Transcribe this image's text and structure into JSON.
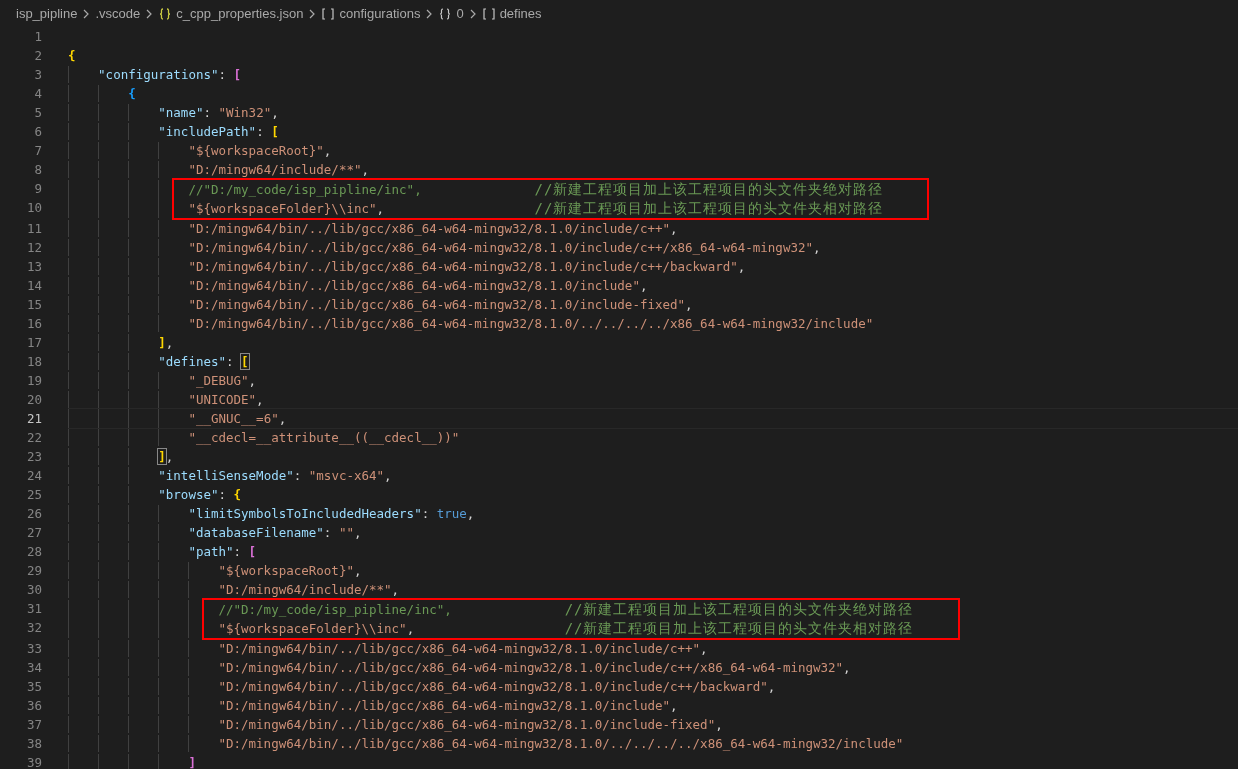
{
  "breadcrumb": [
    {
      "kind": "folder",
      "label": "isp_pipline"
    },
    {
      "kind": "folder",
      "label": ".vscode"
    },
    {
      "kind": "file",
      "label": "c_cpp_properties.json"
    },
    {
      "kind": "array",
      "label": "configurations"
    },
    {
      "kind": "object",
      "label": "0"
    },
    {
      "kind": "array",
      "label": "defines"
    }
  ],
  "lines": [
    {
      "number": "1",
      "active": false,
      "boxed": false
    },
    {
      "number": "2",
      "active": false,
      "boxed": false,
      "tokens": [
        {
          "kind": "bracket",
          "text": "{",
          "color": "#ffd700",
          "matched": false
        }
      ],
      "children": [
        {
          "number": "3",
          "active": false,
          "boxed": false,
          "tokens": [
            {
              "kind": "key",
              "text": "\"configurations\""
            },
            {
              "kind": "punct",
              "text": ": "
            },
            {
              "kind": "bracket",
              "text": "[",
              "color": "#da70d6",
              "matched": false
            }
          ],
          "children": [
            {
              "number": "4",
              "active": false,
              "boxed": false,
              "tokens": [
                {
                  "kind": "bracket",
                  "text": "{",
                  "color": "#179fff",
                  "matched": false
                }
              ],
              "children": [
                {
                  "number": "5",
                  "active": false,
                  "boxed": false,
                  "tokens": [
                    {
                      "kind": "key",
                      "text": "\"name\""
                    },
                    {
                      "kind": "punct",
                      "text": ": "
                    },
                    {
                      "kind": "string",
                      "text": "\"Win32\""
                    },
                    {
                      "kind": "punct",
                      "text": ","
                    }
                  ]
                },
                {
                  "number": "6",
                  "active": false,
                  "boxed": false,
                  "tokens": [
                    {
                      "kind": "key",
                      "text": "\"includePath\""
                    },
                    {
                      "kind": "punct",
                      "text": ": "
                    },
                    {
                      "kind": "bracket",
                      "text": "[",
                      "color": "#ffd700",
                      "matched": false
                    }
                  ],
                  "children": [
                    {
                      "number": "7",
                      "active": false,
                      "boxed": false,
                      "tokens": [
                        {
                          "kind": "string",
                          "text": "\"${workspaceRoot}\""
                        },
                        {
                          "kind": "punct",
                          "text": ","
                        }
                      ]
                    },
                    {
                      "number": "8",
                      "active": false,
                      "boxed": false,
                      "tokens": [
                        {
                          "kind": "string",
                          "text": "\"D:/mingw64/include/**\""
                        },
                        {
                          "kind": "punct",
                          "text": ","
                        }
                      ]
                    },
                    {
                      "number": "9",
                      "active": false,
                      "boxed": true,
                      "tokens": [
                        {
                          "kind": "comment",
                          "text": "//\"D:/my_code/isp_pipline/inc\","
                        }
                      ],
                      "note": "//新建工程项目加上该工程项目的头文件夹绝对路径"
                    },
                    {
                      "number": "10",
                      "active": false,
                      "boxed": true,
                      "tokens": [
                        {
                          "kind": "string",
                          "text": "\"${workspaceFolder}\\\\inc\""
                        },
                        {
                          "kind": "punct",
                          "text": ","
                        }
                      ],
                      "note": "//新建工程项目加上该工程项目的头文件夹相对路径"
                    },
                    {
                      "number": "11",
                      "active": false,
                      "boxed": false,
                      "tokens": [
                        {
                          "kind": "string",
                          "text": "\"D:/mingw64/bin/../lib/gcc/x86_64-w64-mingw32/8.1.0/include/c++\""
                        },
                        {
                          "kind": "punct",
                          "text": ","
                        }
                      ]
                    },
                    {
                      "number": "12",
                      "active": false,
                      "boxed": false,
                      "tokens": [
                        {
                          "kind": "string",
                          "text": "\"D:/mingw64/bin/../lib/gcc/x86_64-w64-mingw32/8.1.0/include/c++/x86_64-w64-mingw32\""
                        },
                        {
                          "kind": "punct",
                          "text": ","
                        }
                      ]
                    },
                    {
                      "number": "13",
                      "active": false,
                      "boxed": false,
                      "tokens": [
                        {
                          "kind": "string",
                          "text": "\"D:/mingw64/bin/../lib/gcc/x86_64-w64-mingw32/8.1.0/include/c++/backward\""
                        },
                        {
                          "kind": "punct",
                          "text": ","
                        }
                      ]
                    },
                    {
                      "number": "14",
                      "active": false,
                      "boxed": false,
                      "tokens": [
                        {
                          "kind": "string",
                          "text": "\"D:/mingw64/bin/../lib/gcc/x86_64-w64-mingw32/8.1.0/include\""
                        },
                        {
                          "kind": "punct",
                          "text": ","
                        }
                      ]
                    },
                    {
                      "number": "15",
                      "active": false,
                      "boxed": false,
                      "tokens": [
                        {
                          "kind": "string",
                          "text": "\"D:/mingw64/bin/../lib/gcc/x86_64-w64-mingw32/8.1.0/include-fixed\""
                        },
                        {
                          "kind": "punct",
                          "text": ","
                        }
                      ]
                    },
                    {
                      "number": "16",
                      "active": false,
                      "boxed": false,
                      "tokens": [
                        {
                          "kind": "string",
                          "text": "\"D:/mingw64/bin/../lib/gcc/x86_64-w64-mingw32/8.1.0/../../../../x86_64-w64-mingw32/include\""
                        }
                      ]
                    }
                  ]
                },
                {
                  "number": "17",
                  "active": false,
                  "boxed": false,
                  "tokens": [
                    {
                      "kind": "bracket",
                      "text": "]",
                      "color": "#ffd700",
                      "matched": false
                    },
                    {
                      "kind": "punct",
                      "text": ","
                    }
                  ]
                },
                {
                  "number": "18",
                  "active": false,
                  "boxed": false,
                  "tokens": [
                    {
                      "kind": "key",
                      "text": "\"defines\""
                    },
                    {
                      "kind": "punct",
                      "text": ": "
                    },
                    {
                      "kind": "bracket",
                      "text": "[",
                      "color": "#ffd700",
                      "matched": true
                    }
                  ],
                  "children": [
                    {
                      "number": "19",
                      "active": false,
                      "boxed": false,
                      "tokens": [
                        {
                          "kind": "string",
                          "text": "\"_DEBUG\""
                        },
                        {
                          "kind": "punct",
                          "text": ","
                        }
                      ]
                    },
                    {
                      "number": "20",
                      "active": false,
                      "boxed": false,
                      "tokens": [
                        {
                          "kind": "string",
                          "text": "\"UNICODE\""
                        },
                        {
                          "kind": "punct",
                          "text": ","
                        }
                      ]
                    },
                    {
                      "number": "21",
                      "active": true,
                      "boxed": false,
                      "tokens": [
                        {
                          "kind": "string",
                          "text": "\"__GNUC__=6\""
                        },
                        {
                          "kind": "punct",
                          "text": ","
                        }
                      ]
                    },
                    {
                      "number": "22",
                      "active": false,
                      "boxed": false,
                      "tokens": [
                        {
                          "kind": "string",
                          "text": "\"__cdecl=__attribute__((__cdecl__))\""
                        }
                      ]
                    }
                  ]
                },
                {
                  "number": "23",
                  "active": false,
                  "boxed": false,
                  "tokens": [
                    {
                      "kind": "bracket",
                      "text": "]",
                      "color": "#ffd700",
                      "matched": true
                    },
                    {
                      "kind": "punct",
                      "text": ","
                    }
                  ]
                },
                {
                  "number": "24",
                  "active": false,
                  "boxed": false,
                  "tokens": [
                    {
                      "kind": "key",
                      "text": "\"intelliSenseMode\""
                    },
                    {
                      "kind": "punct",
                      "text": ": "
                    },
                    {
                      "kind": "string",
                      "text": "\"msvc-x64\""
                    },
                    {
                      "kind": "punct",
                      "text": ","
                    }
                  ]
                },
                {
                  "number": "25",
                  "active": false,
                  "boxed": false,
                  "tokens": [
                    {
                      "kind": "key",
                      "text": "\"browse\""
                    },
                    {
                      "kind": "punct",
                      "text": ": "
                    },
                    {
                      "kind": "bracket",
                      "text": "{",
                      "color": "#ffd700",
                      "matched": false
                    }
                  ],
                  "children": [
                    {
                      "number": "26",
                      "active": false,
                      "boxed": false,
                      "tokens": [
                        {
                          "kind": "key",
                          "text": "\"limitSymbolsToIncludedHeaders\""
                        },
                        {
                          "kind": "punct",
                          "text": ": "
                        },
                        {
                          "kind": "bool",
                          "text": "true"
                        },
                        {
                          "kind": "punct",
                          "text": ","
                        }
                      ]
                    },
                    {
                      "number": "27",
                      "active": false,
                      "boxed": false,
                      "tokens": [
                        {
                          "kind": "key",
                          "text": "\"databaseFilename\""
                        },
                        {
                          "kind": "punct",
                          "text": ": "
                        },
                        {
                          "kind": "string",
                          "text": "\"\""
                        },
                        {
                          "kind": "punct",
                          "text": ","
                        }
                      ]
                    },
                    {
                      "number": "28",
                      "active": false,
                      "boxed": false,
                      "tokens": [
                        {
                          "kind": "key",
                          "text": "\"path\""
                        },
                        {
                          "kind": "punct",
                          "text": ": "
                        },
                        {
                          "kind": "bracket",
                          "text": "[",
                          "color": "#da70d6",
                          "matched": false
                        }
                      ],
                      "children": [
                        {
                          "number": "29",
                          "active": false,
                          "boxed": false,
                          "tokens": [
                            {
                              "kind": "string",
                              "text": "\"${workspaceRoot}\""
                            },
                            {
                              "kind": "punct",
                              "text": ","
                            }
                          ]
                        },
                        {
                          "number": "30",
                          "active": false,
                          "boxed": false,
                          "tokens": [
                            {
                              "kind": "string",
                              "text": "\"D:/mingw64/include/**\""
                            },
                            {
                              "kind": "punct",
                              "text": ","
                            }
                          ]
                        },
                        {
                          "number": "31",
                          "active": false,
                          "boxed": true,
                          "tokens": [
                            {
                              "kind": "comment",
                              "text": "//\"D:/my_code/isp_pipline/inc\","
                            }
                          ],
                          "note": "//新建工程项目加上该工程项目的头文件夹绝对路径"
                        },
                        {
                          "number": "32",
                          "active": false,
                          "boxed": true,
                          "tokens": [
                            {
                              "kind": "string",
                              "text": "\"${workspaceFolder}\\\\inc\""
                            },
                            {
                              "kind": "punct",
                              "text": ","
                            }
                          ],
                          "note": "//新建工程项目加上该工程项目的头文件夹相对路径"
                        },
                        {
                          "number": "33",
                          "active": false,
                          "boxed": false,
                          "tokens": [
                            {
                              "kind": "string",
                              "text": "\"D:/mingw64/bin/../lib/gcc/x86_64-w64-mingw32/8.1.0/include/c++\""
                            },
                            {
                              "kind": "punct",
                              "text": ","
                            }
                          ]
                        },
                        {
                          "number": "34",
                          "active": false,
                          "boxed": false,
                          "tokens": [
                            {
                              "kind": "string",
                              "text": "\"D:/mingw64/bin/../lib/gcc/x86_64-w64-mingw32/8.1.0/include/c++/x86_64-w64-mingw32\""
                            },
                            {
                              "kind": "punct",
                              "text": ","
                            }
                          ]
                        },
                        {
                          "number": "35",
                          "active": false,
                          "boxed": false,
                          "tokens": [
                            {
                              "kind": "string",
                              "text": "\"D:/mingw64/bin/../lib/gcc/x86_64-w64-mingw32/8.1.0/include/c++/backward\""
                            },
                            {
                              "kind": "punct",
                              "text": ","
                            }
                          ]
                        },
                        {
                          "number": "36",
                          "active": false,
                          "boxed": false,
                          "tokens": [
                            {
                              "kind": "string",
                              "text": "\"D:/mingw64/bin/../lib/gcc/x86_64-w64-mingw32/8.1.0/include\""
                            },
                            {
                              "kind": "punct",
                              "text": ","
                            }
                          ]
                        },
                        {
                          "number": "37",
                          "active": false,
                          "boxed": false,
                          "tokens": [
                            {
                              "kind": "string",
                              "text": "\"D:/mingw64/bin/../lib/gcc/x86_64-w64-mingw32/8.1.0/include-fixed\""
                            },
                            {
                              "kind": "punct",
                              "text": ","
                            }
                          ]
                        },
                        {
                          "number": "38",
                          "active": false,
                          "boxed": false,
                          "tokens": [
                            {
                              "kind": "string",
                              "text": "\"D:/mingw64/bin/../lib/gcc/x86_64-w64-mingw32/8.1.0/../../../../x86_64-w64-mingw32/include\""
                            }
                          ]
                        }
                      ]
                    },
                    {
                      "number": "39",
                      "active": false,
                      "boxed": false,
                      "tokens": [
                        {
                          "kind": "bracket",
                          "text": "]",
                          "color": "#da70d6",
                          "matched": false
                        }
                      ]
                    }
                  ]
                }
              ]
            }
          ]
        }
      ]
    }
  ]
}
